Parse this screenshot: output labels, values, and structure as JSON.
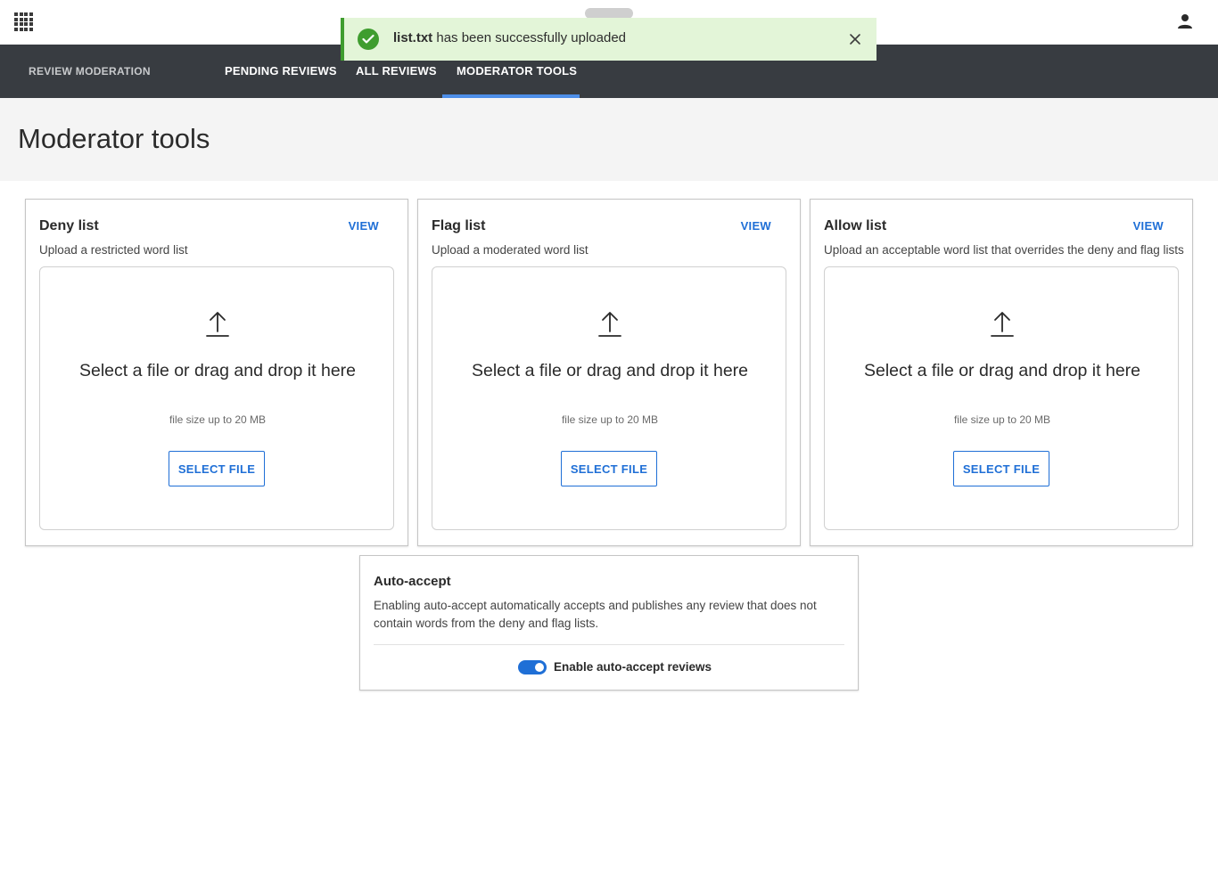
{
  "toast": {
    "filename": "list.txt",
    "message": " has been successfully uploaded",
    "status_color": "#3f9d2f"
  },
  "nav": {
    "brand": "REVIEW MODERATION",
    "tabs": [
      {
        "label": "PENDING REVIEWS"
      },
      {
        "label": "ALL REVIEWS"
      },
      {
        "label": "MODERATOR TOOLS",
        "active": true
      }
    ],
    "accent": "#4d8ee8"
  },
  "page": {
    "title": "Moderator tools"
  },
  "cards": [
    {
      "title": "Deny list",
      "view_label": "VIEW",
      "subtitle": "Upload a restricted word list",
      "dropzone_title": "Select a file or drag and drop it here",
      "dropzone_size": "file size up to 20 MB",
      "button_label": "SELECT FILE"
    },
    {
      "title": "Flag list",
      "view_label": "VIEW",
      "subtitle": "Upload a moderated word list",
      "dropzone_title": "Select a file or drag and drop it here",
      "dropzone_size": "file size up to 20 MB",
      "button_label": "SELECT FILE"
    },
    {
      "title": "Allow list",
      "view_label": "VIEW",
      "subtitle": "Upload an acceptable word list that overrides the deny and flag lists",
      "dropzone_title": "Select a file or drag and drop it here",
      "dropzone_size": "file size up to 20 MB",
      "button_label": "SELECT FILE"
    }
  ],
  "auto_accept": {
    "title": "Auto-accept",
    "description": "Enabling auto-accept automatically accepts and publishes any review that does not contain words from the deny and flag lists.",
    "toggle_label": "Enable auto-accept reviews",
    "enabled": true
  },
  "icons": {
    "apps": "apps-grid-icon",
    "user": "user-icon",
    "success": "check-circle-icon",
    "close": "close-icon",
    "upload": "upload-icon"
  },
  "colors": {
    "primary": "#1f6fd6",
    "nav_bg": "#383c41",
    "toast_bg": "#e3f5d8"
  }
}
